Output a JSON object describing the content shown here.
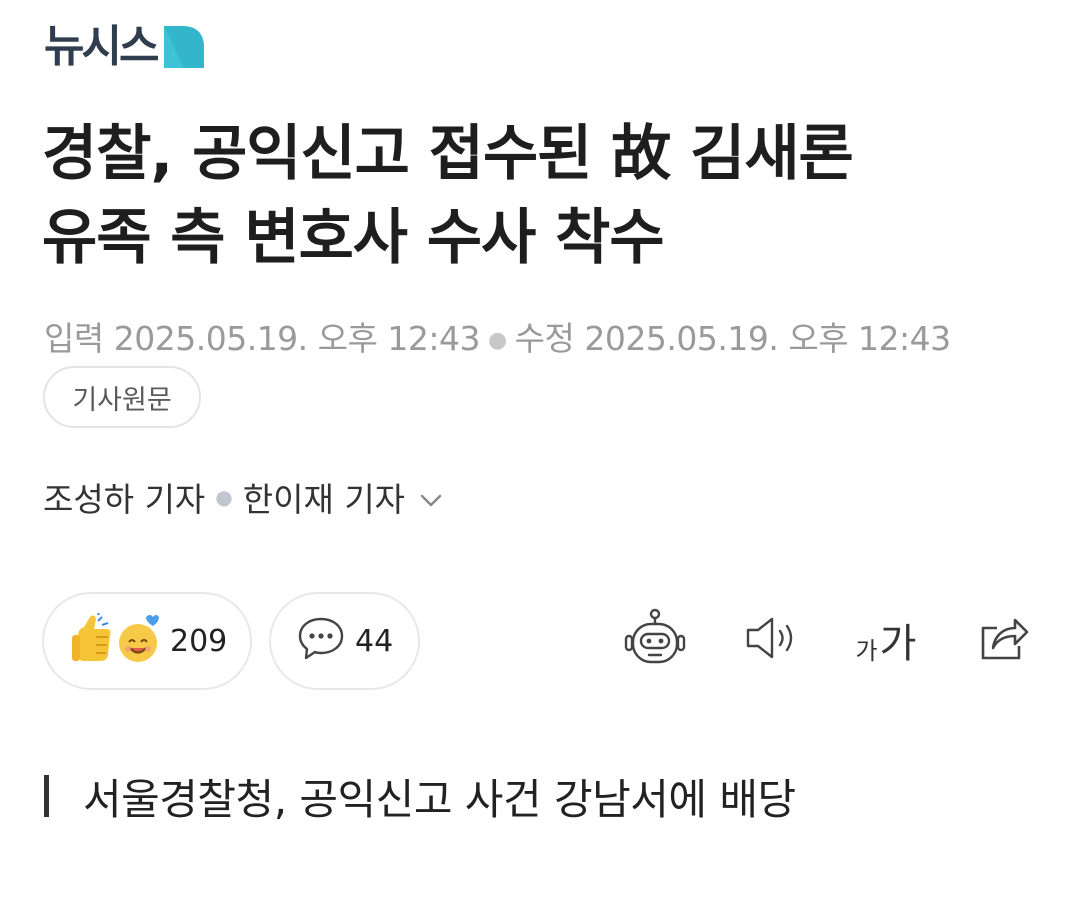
{
  "brand": {
    "logo_text": "뉴시스",
    "logo_color": "#2f3d4e",
    "logo_mark_color": "#3cc3d6"
  },
  "article": {
    "title_line1": "경찰, 공익신고 접수된 故 김새론",
    "title_line2": "유족 측 변호사 수사 착수",
    "input_label": "입력",
    "input_datetime": "2025.05.19. 오후 12:43",
    "modified_label": "수정",
    "modified_datetime": "2025.05.19. 오후 12:43",
    "original_button": "기사원문",
    "reporter1": "조성하 기자",
    "reporter2": "한이재 기자",
    "subheading": "서울경찰청, 공익신고 사건 강남서에 배당"
  },
  "actions": {
    "reactions_count": "209",
    "comments_count": "44",
    "font_small": "가",
    "font_big": "가",
    "icons": [
      "like-emoji-icon",
      "heart-emoji-icon",
      "comment-icon",
      "robot-summary-icon",
      "speaker-icon",
      "font-size-icon",
      "share-icon",
      "chevron-down-icon"
    ]
  }
}
